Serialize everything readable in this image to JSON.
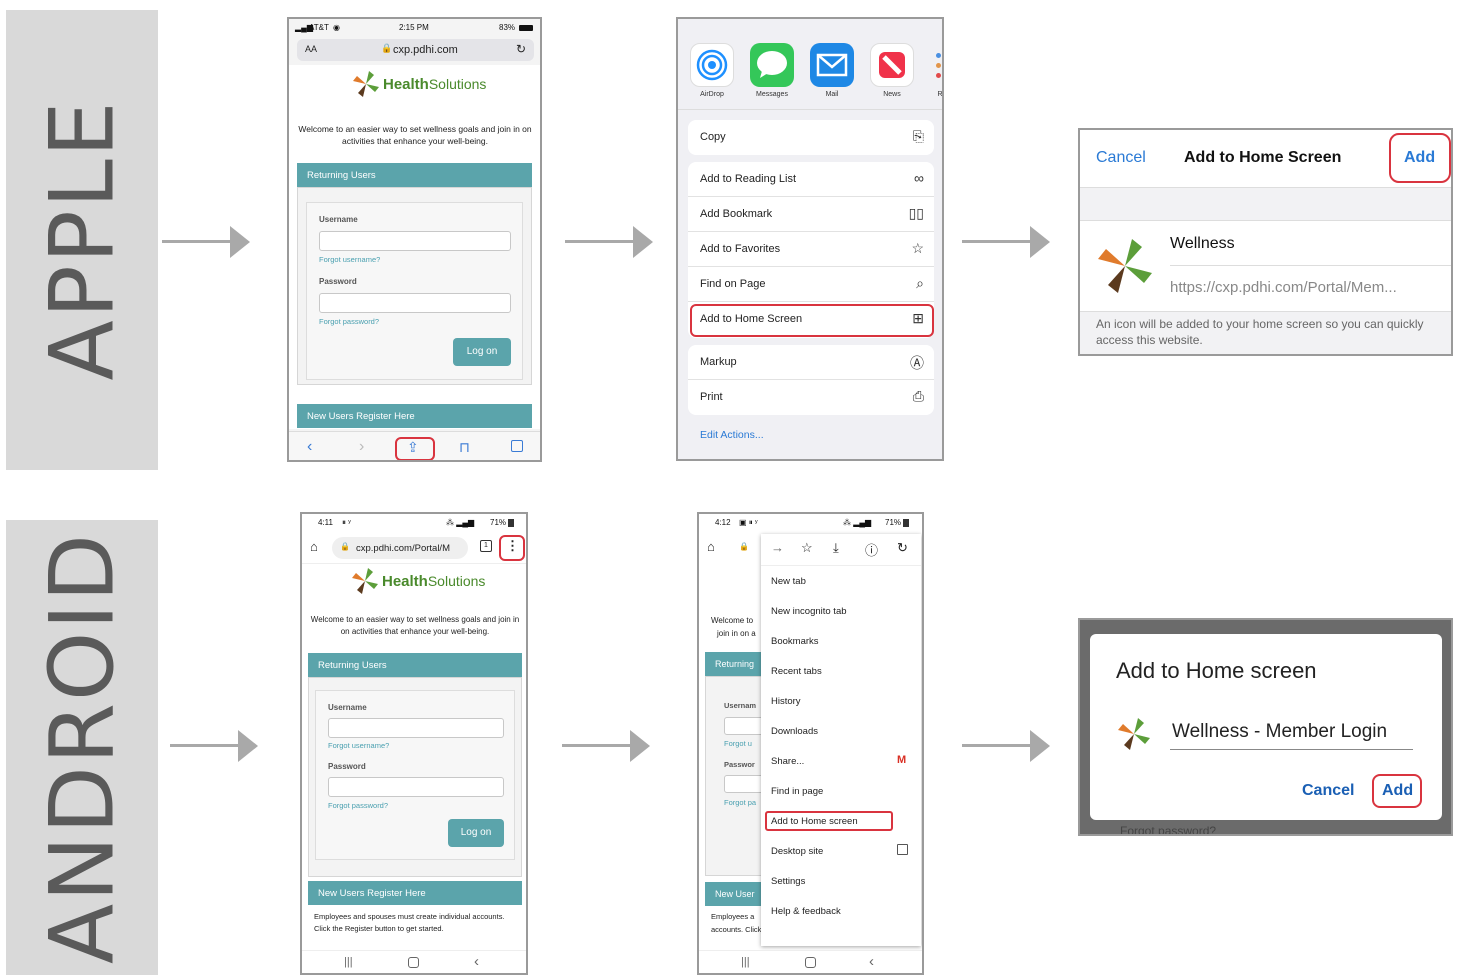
{
  "bands": {
    "apple": "APPLE",
    "android": "ANDROID"
  },
  "apple": {
    "step1": {
      "carrier": "AT&T",
      "time": "2:15 PM",
      "battery": "83%",
      "text_size_icon": "AA",
      "url": "cxp.pdhi.com",
      "logo_health": "Health",
      "logo_solutions": "Solutions",
      "welcome": "Welcome to an easier way to set wellness goals and join in on activities that enhance your well-being.",
      "returning_users": "Returning Users",
      "username_label": "Username",
      "forgot_username": "Forgot username?",
      "password_label": "Password",
      "forgot_password": "Forgot password?",
      "logon": "Log on",
      "new_users": "New Users Register Here"
    },
    "step2": {
      "apps": [
        "AirDrop",
        "Messages",
        "Mail",
        "News",
        "Re"
      ],
      "actions_a": [
        "Copy"
      ],
      "actions_b": [
        "Add to Reading List",
        "Add Bookmark",
        "Add to Favorites",
        "Find on Page",
        "Add to Home Screen"
      ],
      "actions_c": [
        "Markup",
        "Print"
      ],
      "edit_actions": "Edit Actions..."
    },
    "step3": {
      "cancel": "Cancel",
      "title": "Add to Home Screen",
      "add": "Add",
      "name": "Wellness",
      "url": "https://cxp.pdhi.com/Portal/Mem...",
      "note": "An icon will be added to your home screen so you can quickly access this website."
    }
  },
  "android": {
    "step1": {
      "time": "4:11",
      "battery": "71%",
      "url": "cxp.pdhi.com/Portal/M",
      "logo_health": "Health",
      "logo_solutions": "Solutions",
      "welcome": "Welcome to an easier way to set wellness goals and join in on activities that enhance your well-being.",
      "returning_users": "Returning Users",
      "username_label": "Username",
      "forgot_username": "Forgot username?",
      "password_label": "Password",
      "forgot_password": "Forgot password?",
      "logon": "Log on",
      "new_users": "New Users Register Here",
      "employees": "Employees and spouses must create individual accounts. Click the Register button to get started."
    },
    "step2": {
      "time": "4:12",
      "battery": "71%",
      "menu_items": [
        "New tab",
        "New incognito tab",
        "Bookmarks",
        "Recent tabs",
        "History",
        "Downloads",
        "Share...",
        "Find in page",
        "Add to Home screen",
        "Desktop site",
        "Settings",
        "Help & feedback"
      ],
      "bg_welcome": "Welcome to",
      "bg_join": "join in on a",
      "bg_returning": "Returning",
      "bg_username": "Usernam",
      "bg_forgot_u": "Forgot u",
      "bg_password": "Passwor",
      "bg_forgot_p": "Forgot pa",
      "bg_new_users": "New User",
      "bg_employees": "Employees a",
      "bg_accounts": "accounts. Click the Register button to get started."
    },
    "step3": {
      "title": "Add to Home screen",
      "name": "Wellness - Member Login",
      "cancel": "Cancel",
      "add": "Add",
      "behind": "Forgot password?"
    }
  }
}
